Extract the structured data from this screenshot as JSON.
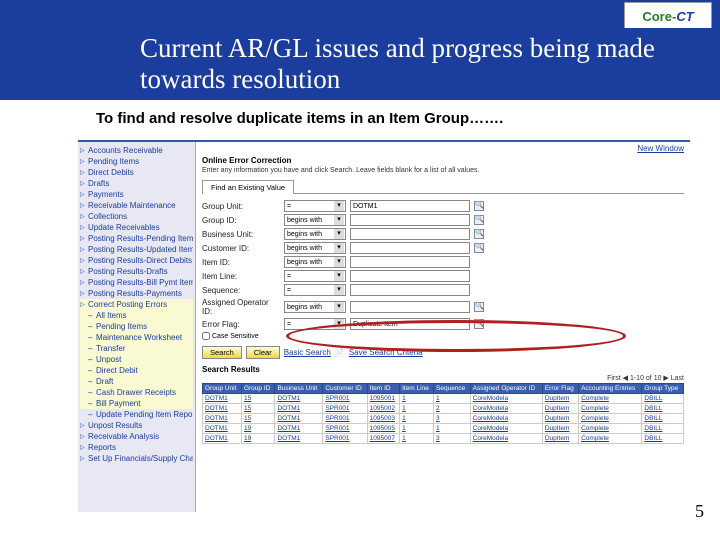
{
  "logo": {
    "core": "Core",
    "sep": "-",
    "ct": "CT"
  },
  "title": "Current AR/GL issues and progress being made towards resolution",
  "subtitle": "To find and resolve duplicate items in an Item Group…….",
  "page_number": "5",
  "sidebar": {
    "items": [
      {
        "label": "Accounts Receivable",
        "cls": "top"
      },
      {
        "label": "Pending Items",
        "cls": "top"
      },
      {
        "label": "Direct Debits",
        "cls": "top"
      },
      {
        "label": "Drafts",
        "cls": "top"
      },
      {
        "label": "Payments",
        "cls": "top"
      },
      {
        "label": "Receivable Maintenance",
        "cls": "top"
      },
      {
        "label": "Collections",
        "cls": "top"
      },
      {
        "label": "Update Receivables",
        "cls": "top"
      },
      {
        "label": "Posting Results-Pending Items",
        "cls": "top"
      },
      {
        "label": "Posting Results-Updated Items",
        "cls": "top"
      },
      {
        "label": "Posting Results-Direct Debits",
        "cls": "top"
      },
      {
        "label": "Posting Results-Drafts",
        "cls": "top"
      },
      {
        "label": "Posting Results-Bill Pymt Items",
        "cls": "top"
      },
      {
        "label": "Posting Results-Payments",
        "cls": "top"
      },
      {
        "label": "Correct Posting Errors",
        "cls": "top hl"
      },
      {
        "label": "All Items",
        "cls": "sub hl"
      },
      {
        "label": "Pending Items",
        "cls": "sub hl"
      },
      {
        "label": "Maintenance Worksheet",
        "cls": "sub hl"
      },
      {
        "label": "Transfer",
        "cls": "sub hl"
      },
      {
        "label": "Unpost",
        "cls": "sub hl"
      },
      {
        "label": "Direct Debit",
        "cls": "sub hl"
      },
      {
        "label": "Draft",
        "cls": "sub hl"
      },
      {
        "label": "Cash Drawer Receipts",
        "cls": "sub hl"
      },
      {
        "label": "Bill Payment",
        "cls": "sub hl"
      },
      {
        "label": "Update Pending Item Report",
        "cls": "sub"
      },
      {
        "label": "Unpost Results",
        "cls": "top"
      },
      {
        "label": "Receivable Analysis",
        "cls": "top"
      },
      {
        "label": "Reports",
        "cls": "top"
      },
      {
        "label": "Set Up Financials/Supply Chain",
        "cls": "top"
      }
    ]
  },
  "main": {
    "new_window": "New Window",
    "section_title": "Online Error Correction",
    "section_help": "Enter any information you have and click Search. Leave fields blank for a list of all values.",
    "tab": "Find an Existing Value",
    "fields": [
      {
        "label": "Group Unit:",
        "op": "=",
        "val": "DOTM1",
        "lookup": true
      },
      {
        "label": "Group ID:",
        "op": "begins with",
        "val": "",
        "lookup": true
      },
      {
        "label": "Business Unit:",
        "op": "begins with",
        "val": "",
        "lookup": true
      },
      {
        "label": "Customer ID:",
        "op": "begins with",
        "val": "",
        "lookup": true
      },
      {
        "label": "Item ID:",
        "op": "begins with",
        "val": "",
        "lookup": false
      },
      {
        "label": "Item Line:",
        "op": "=",
        "val": "",
        "lookup": false
      },
      {
        "label": "Sequence:",
        "op": "=",
        "val": "",
        "lookup": false
      },
      {
        "label": "Assigned Operator ID:",
        "op": "begins with",
        "val": "",
        "lookup": true
      },
      {
        "label": "Error Flag:",
        "op": "=",
        "val": "Duplicate Item",
        "lookup": true
      }
    ],
    "case_sensitive": "Case Sensitive",
    "buttons": {
      "search": "Search",
      "clear": "Clear",
      "basic": "Basic Search",
      "save": "Save Search Criteria"
    },
    "results_title": "Search Results",
    "results_nav": "First  ◀  1-10 of 10  ▶  Last",
    "columns": [
      "Group Unit",
      "Group ID",
      "Business Unit",
      "Customer ID",
      "Item ID",
      "Item Line",
      "Sequence",
      "Assigned Operator ID",
      "Error Flag",
      "Accounting Entries",
      "Group Type"
    ],
    "rows": [
      [
        "DOTM1",
        "15",
        "DOTM1",
        "SPR001",
        "1095001",
        "1",
        "1",
        "CoreModela",
        "DupItem",
        "Complete",
        "DBILL"
      ],
      [
        "DOTM1",
        "15",
        "DOTM1",
        "SPR001",
        "1095002",
        "1",
        "2",
        "CoreModela",
        "DupItem",
        "Complete",
        "DBILL"
      ],
      [
        "DOTM1",
        "15",
        "DOTM1",
        "SPR001",
        "1095003",
        "1",
        "3",
        "CoreModela",
        "DupItem",
        "Complete",
        "DBILL"
      ],
      [
        "DOTM1",
        "19",
        "DOTM1",
        "SPR001",
        "1095005",
        "1",
        "1",
        "CoreModela",
        "DupItem",
        "Complete",
        "DBILL"
      ],
      [
        "DOTM1",
        "19",
        "DOTM1",
        "SPR001",
        "1095007",
        "1",
        "3",
        "CoreModela",
        "DupItem",
        "Complete",
        "DBILL"
      ]
    ]
  }
}
